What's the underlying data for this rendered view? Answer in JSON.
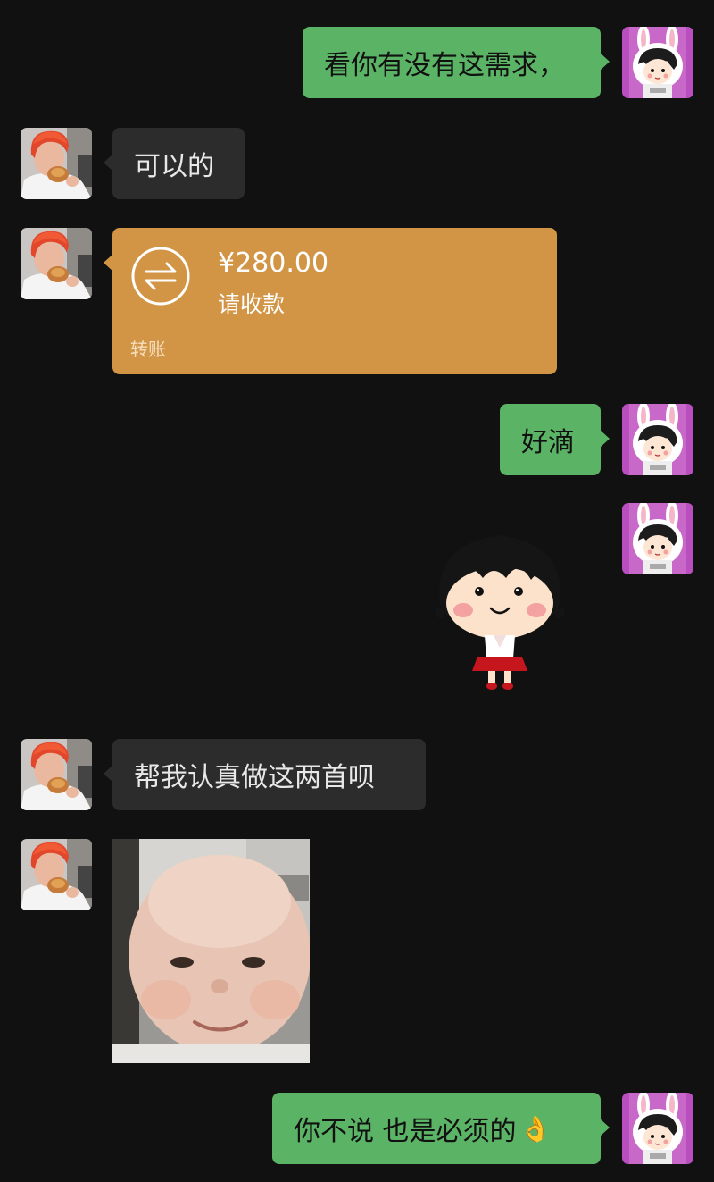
{
  "messages": {
    "m1": {
      "side": "out",
      "text": "看你有没有这需求，"
    },
    "m2": {
      "side": "in",
      "text": "可以的"
    },
    "m3": {
      "side": "in",
      "type": "transfer",
      "amount": "¥280.00",
      "status": "请收款",
      "label": "转账",
      "icon": "transfer-arrows-icon"
    },
    "m4": {
      "side": "out",
      "text": "好滴"
    },
    "m5": {
      "side": "out",
      "type": "sticker",
      "sticker": "maruko-girl-sticker"
    },
    "m6": {
      "side": "in",
      "text": "帮我认真做这两首呗"
    },
    "m7": {
      "side": "in",
      "type": "image",
      "image": "baby-face-meme"
    },
    "m8": {
      "side": "out",
      "text": "你不说 也是必须的",
      "emoji": "👌"
    }
  },
  "colors": {
    "background": "#111111",
    "outgoing_bubble": "#5bb465",
    "incoming_bubble": "#2c2c2c",
    "transfer_card": "#d29545"
  }
}
